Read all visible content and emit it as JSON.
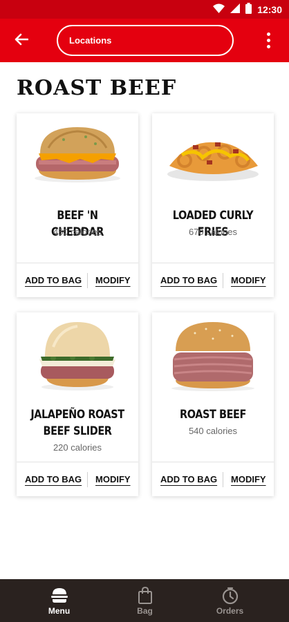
{
  "status_bar": {
    "time": "12:30"
  },
  "app_bar": {
    "location_label": "Locations"
  },
  "page": {
    "title": "ROAST BEEF"
  },
  "products": [
    {
      "name": "BEEF 'N CHEDDAR",
      "calories": "450 calories",
      "add_label": "ADD TO BAG",
      "modify_label": "MODIFY"
    },
    {
      "name": "LOADED CURLY FRIES",
      "calories": "670 calories",
      "add_label": "ADD TO BAG",
      "modify_label": "MODIFY"
    },
    {
      "name": "JALAPEÑO ROAST BEEF SLIDER",
      "calories": "220 calories",
      "add_label": "ADD TO BAG",
      "modify_label": "MODIFY"
    },
    {
      "name": "ROAST BEEF",
      "calories": "540 calories",
      "add_label": "ADD TO BAG",
      "modify_label": "MODIFY"
    }
  ],
  "bottom_nav": [
    {
      "label": "Menu",
      "icon": "burger-icon",
      "active": true
    },
    {
      "label": "Bag",
      "icon": "bag-icon",
      "active": false
    },
    {
      "label": "Orders",
      "icon": "clock-icon",
      "active": false
    }
  ],
  "colors": {
    "brand_red": "#e4000f",
    "status_red": "#c8000f",
    "nav_dark": "#2a221f"
  }
}
